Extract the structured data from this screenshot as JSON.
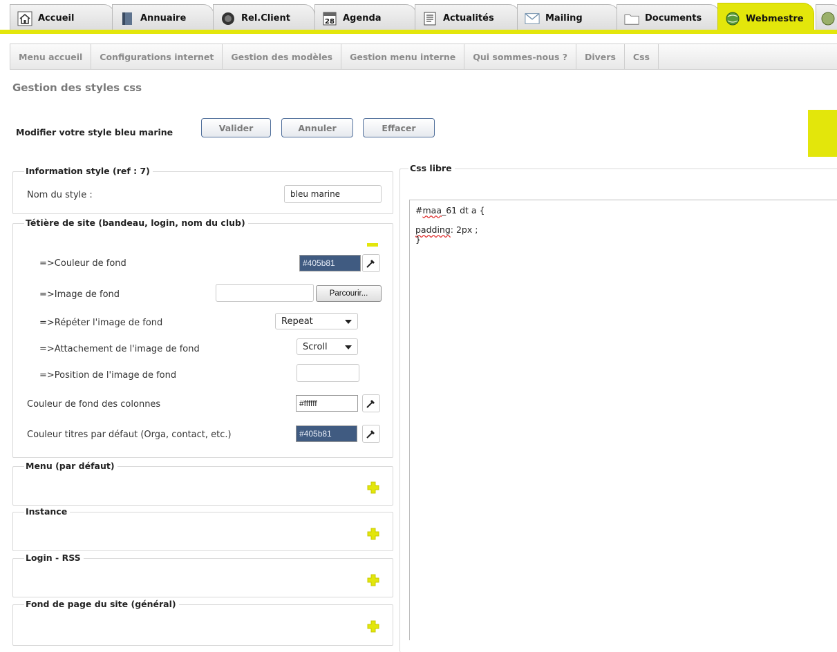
{
  "tabs": [
    {
      "label": "Accueil",
      "icon": "home-icon"
    },
    {
      "label": "Annuaire",
      "icon": "book-icon"
    },
    {
      "label": "Rel.Client",
      "icon": "headset-icon"
    },
    {
      "label": "Agenda",
      "icon": "calendar-icon",
      "icon_text": "28"
    },
    {
      "label": "Actualités",
      "icon": "newspaper-icon"
    },
    {
      "label": "Mailing",
      "icon": "envelope-icon"
    },
    {
      "label": "Documents",
      "icon": "folder-icon"
    },
    {
      "label": "Webmestre",
      "icon": "globe-icon",
      "active": true
    }
  ],
  "subnav": [
    "Menu accueil",
    "Configurations internet",
    "Gestion des modèles",
    "Gestion menu interne",
    "Qui sommes-nous ?",
    "Divers",
    "Css"
  ],
  "page_title": "Gestion des styles css",
  "toolbar": {
    "modify_label": "Modifier votre style bleu marine",
    "validate_label": "Valider",
    "cancel_label": "Annuler",
    "clear_label": "Effacer"
  },
  "info_style": {
    "legend": "Information style (ref : 7)",
    "name_label": "Nom du style :",
    "name_value": "bleu marine"
  },
  "header_section": {
    "legend": "Tétière de site (bandeau, login, nom du club)",
    "bg_color_label": "=>Couleur de fond",
    "bg_color_value": "#405b81",
    "bg_image_label": "=>Image de fond",
    "browse_label": "Parcourir...",
    "repeat_label": "=>Répéter l'image de fond",
    "repeat_value": "Repeat",
    "attach_label": "=>Attachement de l'image de fond",
    "attach_value": "Scroll",
    "position_label": "=>Position de l'image de fond",
    "position_value": "",
    "col_bg_label": "Couleur de fond des colonnes",
    "col_bg_value": "#ffffff",
    "title_color_label": "Couleur titres par défaut (Orga, contact, etc.)",
    "title_color_value": "#405b81"
  },
  "collapsed_sections": [
    {
      "legend": "Menu (par défaut)"
    },
    {
      "legend": "Instance"
    },
    {
      "legend": "Login - RSS"
    },
    {
      "legend": "Fond de page du site (général)"
    }
  ],
  "css_libre": {
    "legend": "Css libre",
    "line1_pre": "#",
    "line1_word": "maa",
    "line1_post": "_61 dt a {",
    "line2": "",
    "line3_word": "padding",
    "line3_post": ": 2px ;",
    "line4": "}"
  },
  "colors": {
    "accent": "#e3e60b",
    "navy": "#405b81",
    "button_border": "#4f6e9a"
  }
}
